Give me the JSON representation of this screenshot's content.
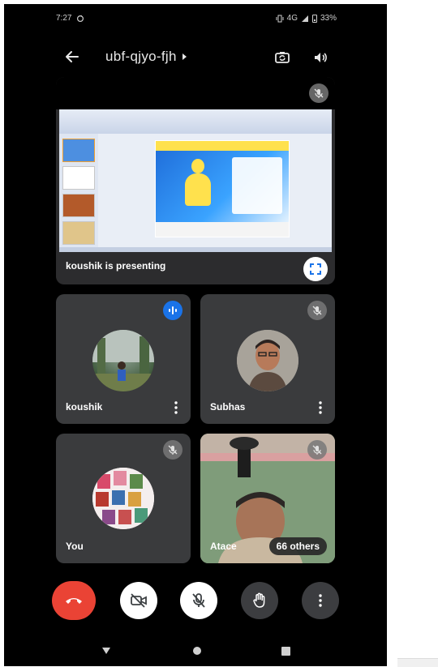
{
  "status": {
    "time": "7:27",
    "network": "4G",
    "battery": "33%"
  },
  "meeting": {
    "code": "ubf-qjyo-fjh"
  },
  "presentation": {
    "label": "koushik is presenting"
  },
  "participants": [
    {
      "name": "koushik",
      "state": "speaking"
    },
    {
      "name": "Subhas",
      "state": "muted"
    },
    {
      "name": "You",
      "state": "muted"
    },
    {
      "name": "Atace",
      "state": "muted"
    }
  ],
  "others_chip": "66 others",
  "colors": {
    "end_call": "#ea4335",
    "speaking": "#1a73e8",
    "tile_bg": "#3a3b3d",
    "screen_bg": "#000000"
  },
  "icons": {
    "back": "arrow-left-icon",
    "camera_switch": "camera-switch-icon",
    "speaker": "speaker-icon",
    "mic_off": "mic-off-icon",
    "speaking": "audio-wave-icon",
    "expand": "fullscreen-icon",
    "more": "more-vert-icon",
    "end_call": "call-end-icon",
    "video_off": "video-off-icon",
    "raise_hand": "raise-hand-icon"
  }
}
